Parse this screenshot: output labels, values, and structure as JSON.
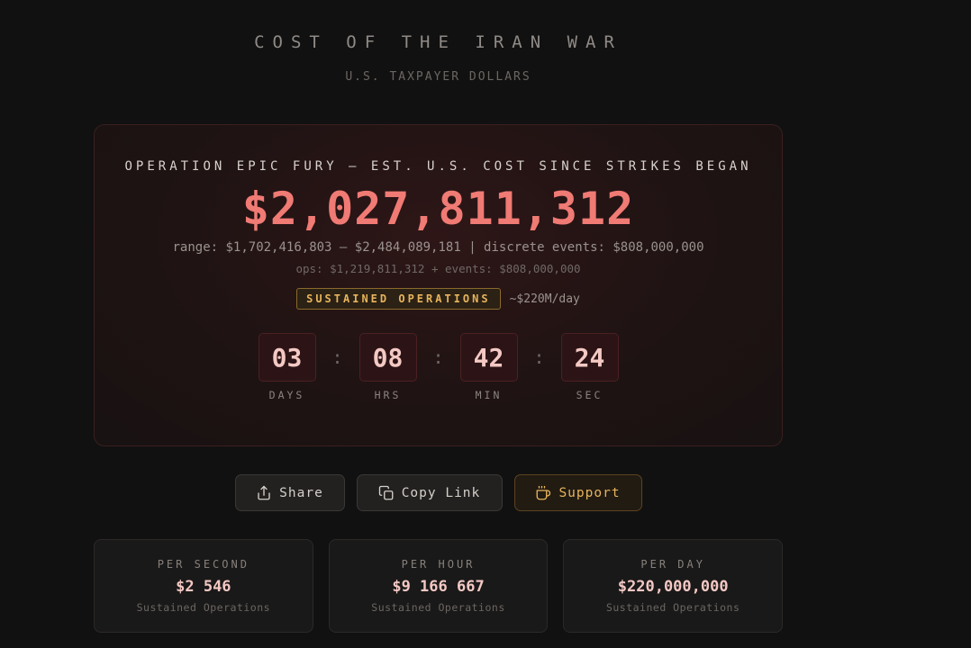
{
  "header": {
    "title": "COST OF THE IRAN WAR",
    "subtitle": "U.S. TAXPAYER DOLLARS"
  },
  "hero": {
    "operation_label": "OPERATION EPIC FURY — EST. U.S. COST SINCE STRIKES BEGAN",
    "amount": "$2,027,811,312",
    "range_text": "range: $1,702,416,803 – $2,484,089,181 | discrete events: $808,000,000",
    "ops_text": "ops: $1,219,811,312 + events: $808,000,000",
    "badge": "SUSTAINED OPERATIONS",
    "rate": "~$220M/day",
    "countdown": [
      {
        "value": "03",
        "label": "DAYS"
      },
      {
        "value": "08",
        "label": "HRS"
      },
      {
        "value": "42",
        "label": "MIN"
      },
      {
        "value": "24",
        "label": "SEC"
      }
    ],
    "separator": ":"
  },
  "actions": {
    "share": "Share",
    "copy_link": "Copy Link",
    "support": "Support"
  },
  "stats": [
    {
      "label": "PER SECOND",
      "value": "$2 546",
      "sub": "Sustained Operations"
    },
    {
      "label": "PER HOUR",
      "value": "$9 166 667",
      "sub": "Sustained Operations"
    },
    {
      "label": "PER DAY",
      "value": "$220,000,000",
      "sub": "Sustained Operations"
    }
  ],
  "colors": {
    "background": "#121111",
    "accent_red": "#f07a74",
    "accent_gold": "#e7b45c"
  },
  "icons": {
    "share": "share-icon",
    "copy": "copy-icon",
    "support": "coffee-cup-icon"
  }
}
